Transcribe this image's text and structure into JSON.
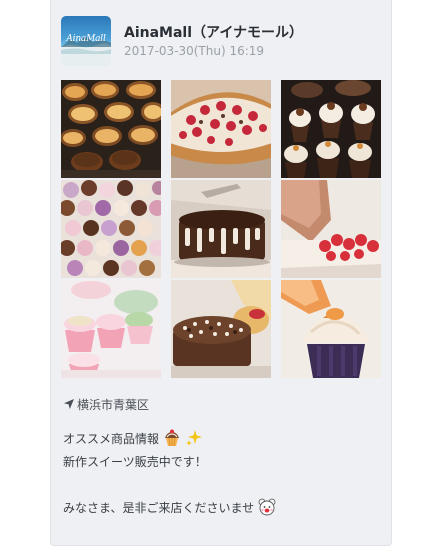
{
  "post": {
    "author": "AinaMall（アイナモール）",
    "timestamp": "2017-03-30(Thu) 16:19",
    "avatar_text": "AinaMall",
    "photos": [
      {
        "name": "photo-muffins"
      },
      {
        "name": "photo-berry-tart"
      },
      {
        "name": "photo-chocolate-cupcakes"
      },
      {
        "name": "photo-cupcake-assortment"
      },
      {
        "name": "photo-chocolate-drip-cake"
      },
      {
        "name": "photo-cream-piping-berries"
      },
      {
        "name": "photo-pastel-cupcakes"
      },
      {
        "name": "photo-chocolate-layer-cake"
      },
      {
        "name": "photo-cream-swirl-cupcake"
      }
    ],
    "location": "横浜市青葉区",
    "lines": {
      "line1": "オススメ商品情報",
      "line2": "新作スイーツ販売中です！",
      "line3": "みなさま、是非ご来店くださいませ"
    },
    "icons": {
      "location": "location-arrow-icon",
      "cupcake": "cupcake-emoji-icon",
      "sparkle": "sparkle-emoji-icon",
      "bear": "bear-emoji-icon"
    }
  }
}
